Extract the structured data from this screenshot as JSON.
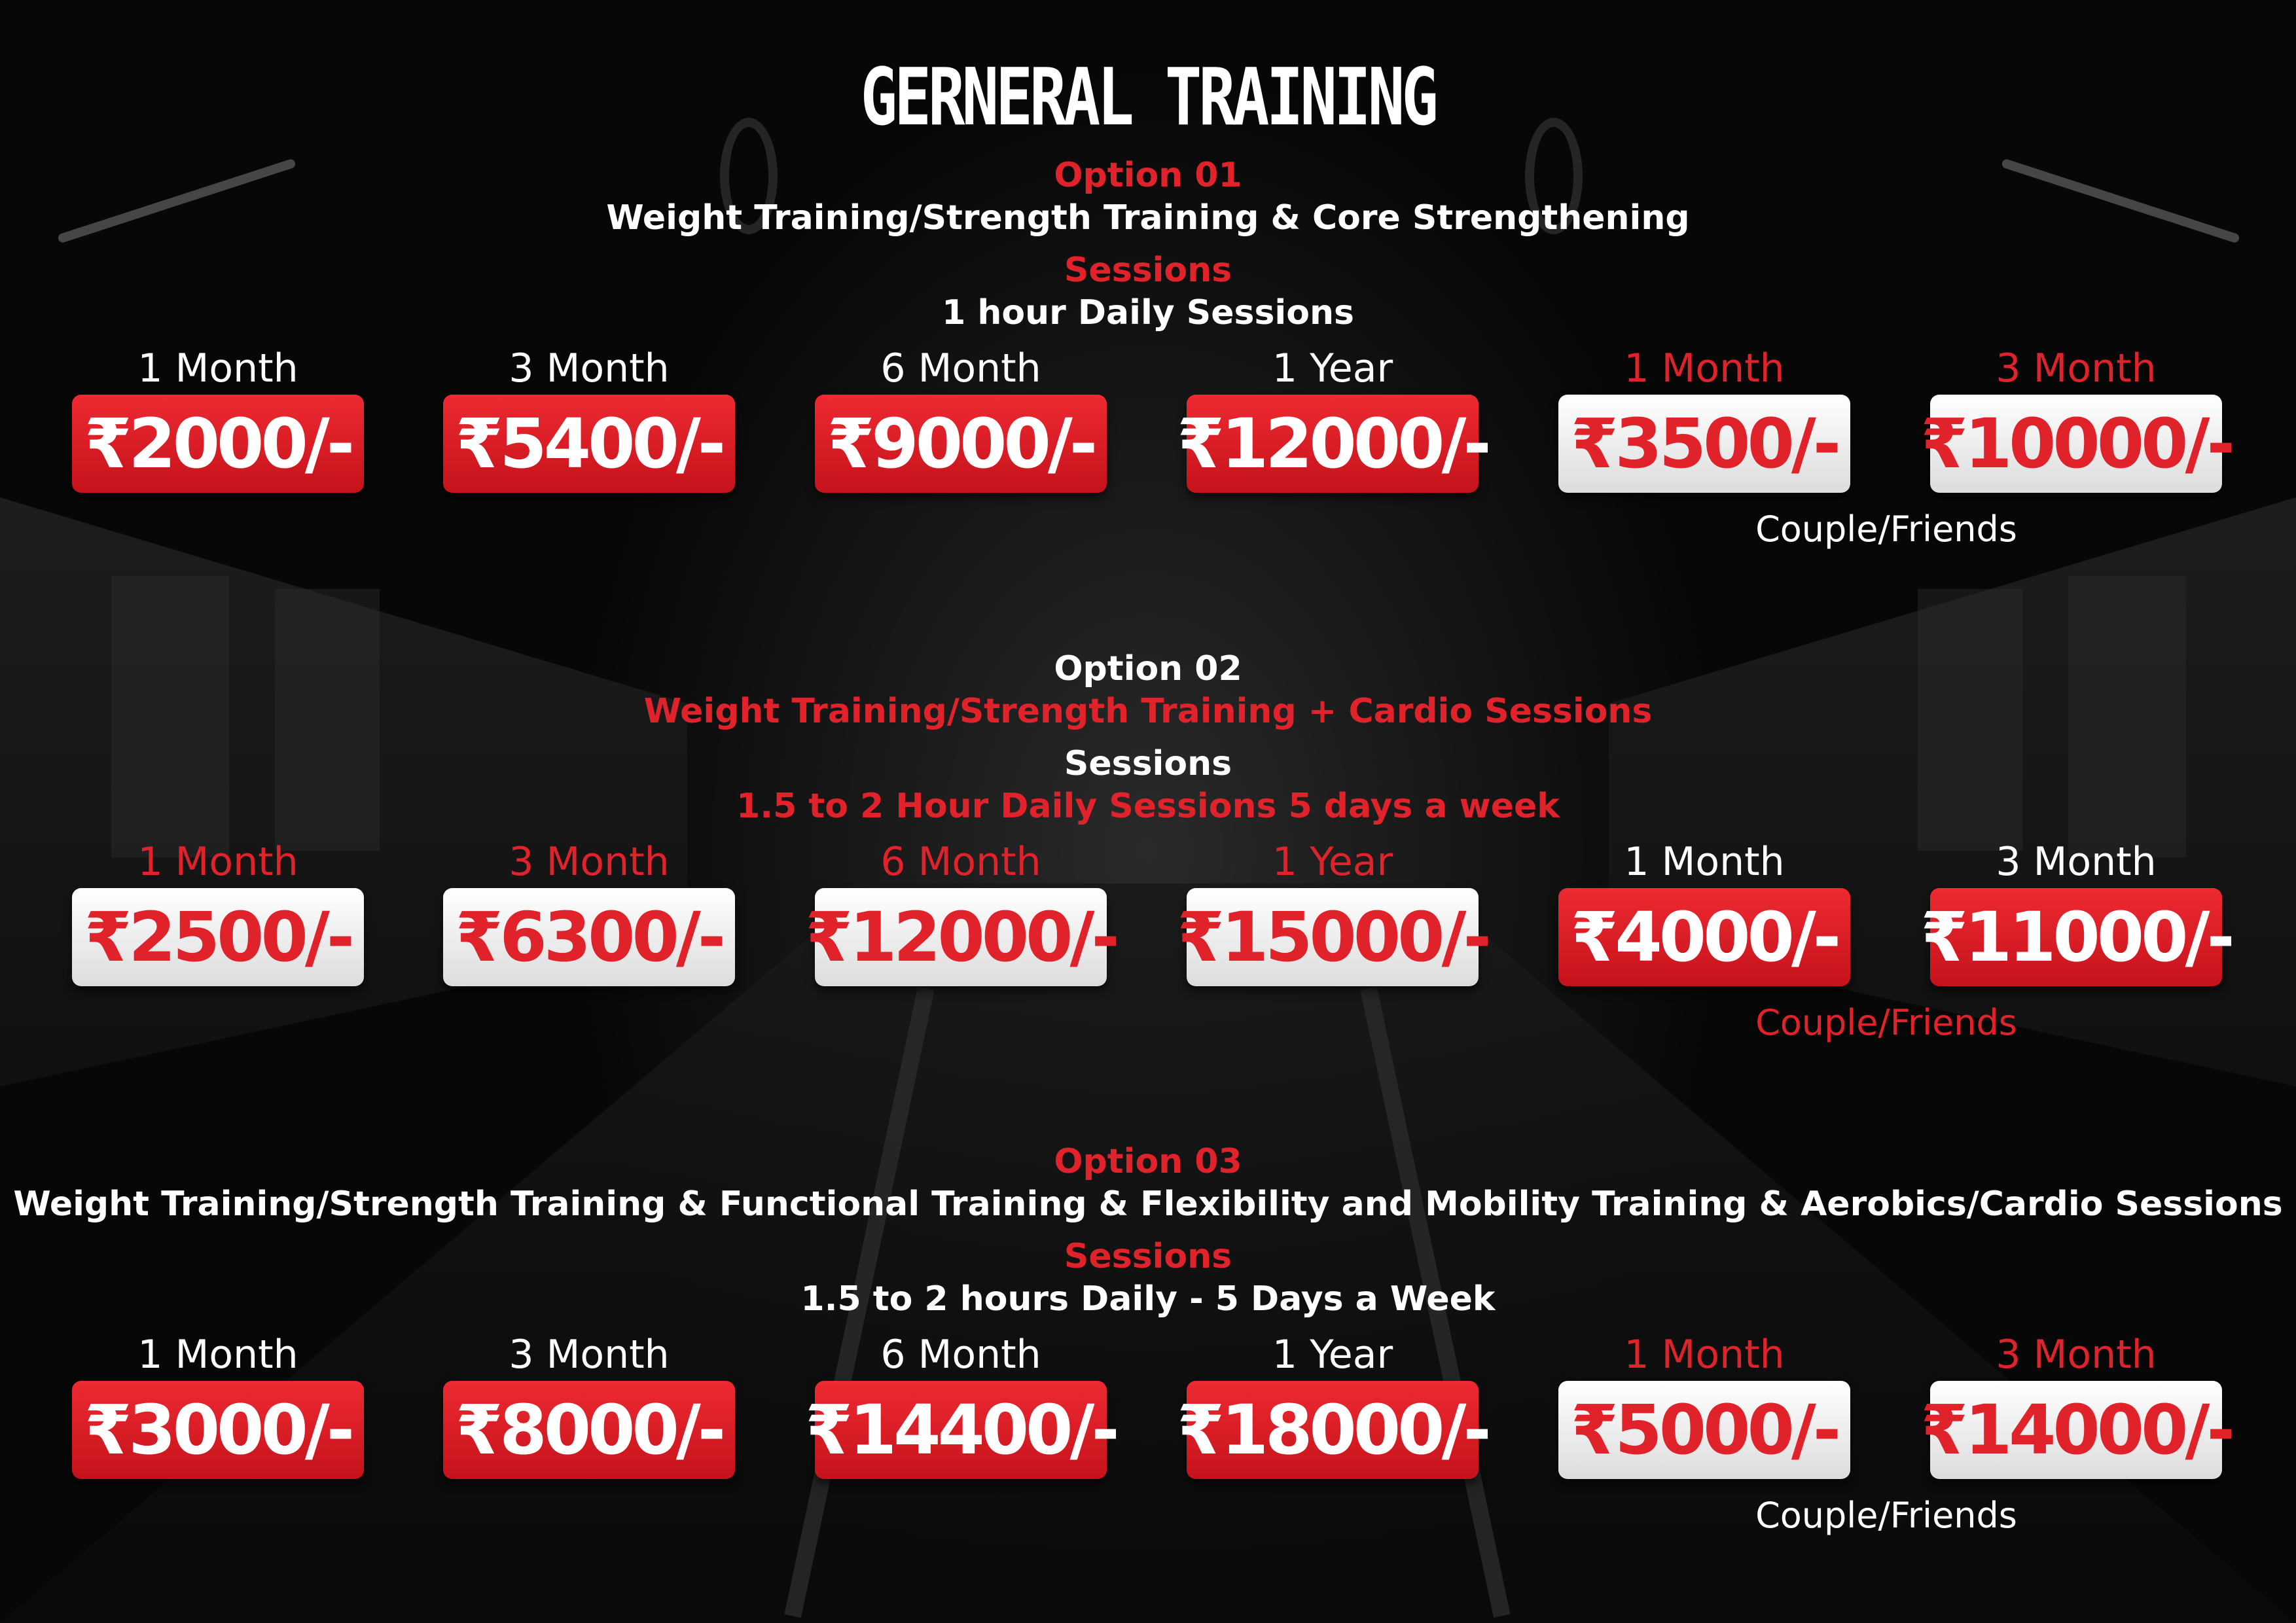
{
  "title": "GERNERAL TRAINING",
  "options": [
    {
      "option_label": "Option 01",
      "option_label_color": "#e0232b",
      "description": "Weight Training/Strength Training & Core Strengthening",
      "description_color": "#ffffff",
      "sessions_label": "Sessions",
      "sessions_label_color": "#e0232b",
      "sessions_detail": "1 hour Daily Sessions",
      "sessions_detail_color": "#ffffff",
      "plans": [
        {
          "period": "1 Month",
          "price": "₹2000/-",
          "label_color": "#ffffff",
          "style": "red"
        },
        {
          "period": "3 Month",
          "price": "₹5400/-",
          "label_color": "#ffffff",
          "style": "red"
        },
        {
          "period": "6 Month",
          "price": "₹9000/-",
          "label_color": "#ffffff",
          "style": "red"
        },
        {
          "period": "1 Year",
          "price": "₹12000/-",
          "label_color": "#ffffff",
          "style": "red"
        },
        {
          "period": "1 Month",
          "price": "₹3500/-",
          "label_color": "#e0232b",
          "style": "white"
        },
        {
          "period": "3 Month",
          "price": "₹10000/-",
          "label_color": "#e0232b",
          "style": "white"
        }
      ],
      "note": "Couple/Friends",
      "note_color": "#ffffff"
    },
    {
      "option_label": "Option 02",
      "option_label_color": "#ffffff",
      "description": "Weight Training/Strength Training + Cardio Sessions",
      "description_color": "#e0232b",
      "sessions_label": "Sessions",
      "sessions_label_color": "#ffffff",
      "sessions_detail": "1.5 to 2 Hour Daily Sessions 5 days a week",
      "sessions_detail_color": "#e0232b",
      "plans": [
        {
          "period": "1 Month",
          "price": "₹2500/-",
          "label_color": "#e0232b",
          "style": "white"
        },
        {
          "period": "3 Month",
          "price": "₹6300/-",
          "label_color": "#e0232b",
          "style": "white"
        },
        {
          "period": "6 Month",
          "price": "₹12000/-",
          "label_color": "#e0232b",
          "style": "white"
        },
        {
          "period": "1 Year",
          "price": "₹15000/-",
          "label_color": "#e0232b",
          "style": "white"
        },
        {
          "period": "1 Month",
          "price": "₹4000/-",
          "label_color": "#ffffff",
          "style": "red"
        },
        {
          "period": "3 Month",
          "price": "₹11000/-",
          "label_color": "#ffffff",
          "style": "red"
        }
      ],
      "note": "Couple/Friends",
      "note_color": "#e0232b"
    },
    {
      "option_label": "Option 03",
      "option_label_color": "#e0232b",
      "description": "Weight Training/Strength Training & Functional Training & Flexibility and Mobility Training & Aerobics/Cardio Sessions",
      "description_color": "#ffffff",
      "sessions_label": "Sessions",
      "sessions_label_color": "#e0232b",
      "sessions_detail": "1.5 to 2 hours Daily - 5 Days a Week",
      "sessions_detail_color": "#ffffff",
      "plans": [
        {
          "period": "1 Month",
          "price": "₹3000/-",
          "label_color": "#ffffff",
          "style": "red"
        },
        {
          "period": "3 Month",
          "price": "₹8000/-",
          "label_color": "#ffffff",
          "style": "red"
        },
        {
          "period": "6 Month",
          "price": "₹14400/-",
          "label_color": "#ffffff",
          "style": "red"
        },
        {
          "period": "1 Year",
          "price": "₹18000/-",
          "label_color": "#ffffff",
          "style": "red"
        },
        {
          "period": "1 Month",
          "price": "₹5000/-",
          "label_color": "#e0232b",
          "style": "white"
        },
        {
          "period": "3 Month",
          "price": "₹14000/-",
          "label_color": "#e0232b",
          "style": "white"
        }
      ],
      "note": "Couple/Friends",
      "note_color": "#ffffff"
    }
  ]
}
